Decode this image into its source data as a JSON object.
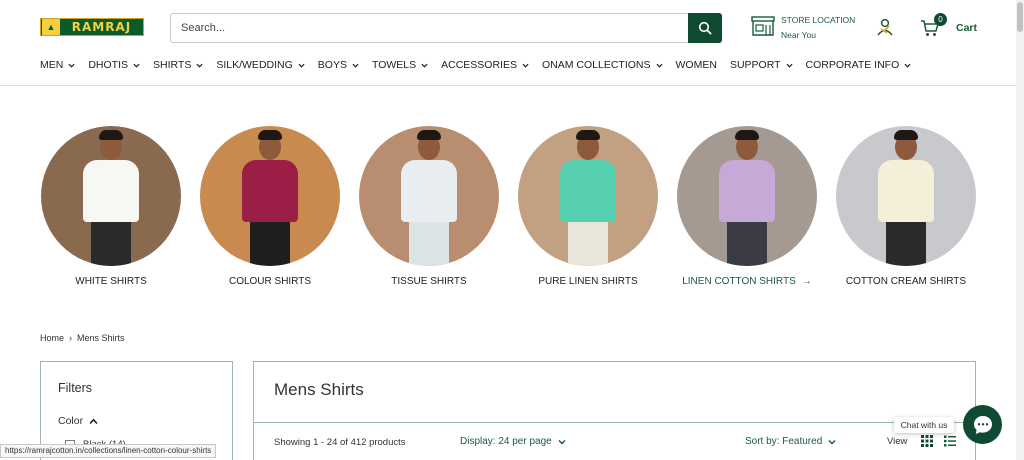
{
  "header": {
    "logo_text": "RAMRAJ",
    "search_placeholder": "Search...",
    "store_location_line1": "STORE LOCATION",
    "store_location_line2": "Near You",
    "cart_count": "0",
    "cart_label": "Cart"
  },
  "nav": {
    "items": [
      {
        "label": "MEN",
        "has_dropdown": true
      },
      {
        "label": "DHOTIS",
        "has_dropdown": true
      },
      {
        "label": "SHIRTS",
        "has_dropdown": true
      },
      {
        "label": "SILK/WEDDING",
        "has_dropdown": true
      },
      {
        "label": "BOYS",
        "has_dropdown": true
      },
      {
        "label": "TOWELS",
        "has_dropdown": true
      },
      {
        "label": "ACCESSORIES",
        "has_dropdown": true
      },
      {
        "label": "ONAM COLLECTIONS",
        "has_dropdown": true
      },
      {
        "label": "WOMEN",
        "has_dropdown": false
      },
      {
        "label": "SUPPORT",
        "has_dropdown": true
      },
      {
        "label": "CORPORATE INFO",
        "has_dropdown": true
      }
    ]
  },
  "categories": [
    {
      "label": "WHITE SHIRTS",
      "bg": "#8a6a4f",
      "shirt": "#f7f7f3",
      "pants": "#2a2a2a"
    },
    {
      "label": "COLOUR SHIRTS",
      "bg": "#c98a4f",
      "shirt": "#9a1e46",
      "pants": "#1f1f1f"
    },
    {
      "label": "TISSUE SHIRTS",
      "bg": "#b98e70",
      "shirt": "#e8eef0",
      "pants": "#dde4e6"
    },
    {
      "label": "PURE LINEN SHIRTS",
      "bg": "#c2a183",
      "shirt": "#56cfb0",
      "pants": "#e9e6dc"
    },
    {
      "label": "LINEN COTTON SHIRTS",
      "bg": "#a59a92",
      "shirt": "#c6a9d6",
      "pants": "#3b3b45",
      "active": true
    },
    {
      "label": "COTTON CREAM SHIRTS",
      "bg": "#c7c9cc",
      "shirt": "#f3efd8",
      "pants": "#2a2a2a"
    }
  ],
  "breadcrumb": {
    "home": "Home",
    "current": "Mens Shirts"
  },
  "filters": {
    "title": "Filters",
    "color_label": "Color",
    "first_option": "Black (14)"
  },
  "listing": {
    "title": "Mens Shirts",
    "showing": "Showing 1 - 24 of 412 products",
    "display": "Display: 24 per page",
    "sort": "Sort by: Featured",
    "view_label": "View"
  },
  "status_url": "https://ramrajcotton.in/collections/linen-cotton-colour-shirts",
  "chat": {
    "tooltip": "Chat with us"
  },
  "colors": {
    "brand_green": "#0f4b33",
    "accent_text": "#1a5c3a"
  }
}
